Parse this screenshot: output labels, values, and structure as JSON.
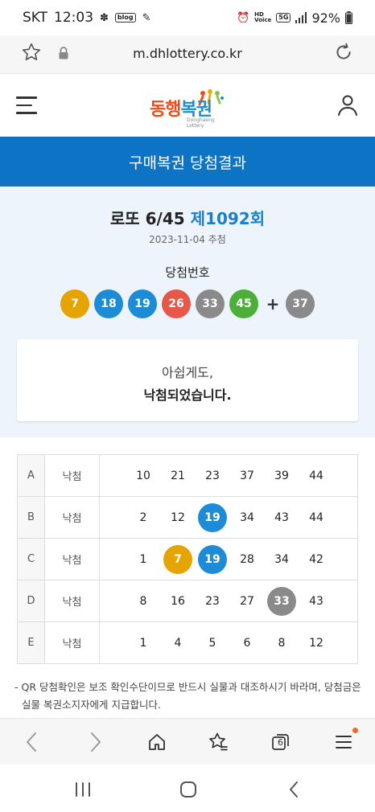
{
  "status": {
    "carrier": "SKT",
    "time": "12:03",
    "blog_badge": "blog",
    "hd_badge": "HD",
    "voice_badge": "Voice",
    "fiveg_badge": "5G",
    "battery": "92%"
  },
  "browser": {
    "url": "m.dhlottery.co.kr",
    "tab_count": "6"
  },
  "header": {
    "logo_text_1": "동행",
    "logo_text_2": "복권",
    "logo_sub": "Donghaeng Lottery"
  },
  "page": {
    "title": "구매복권 당첨결과"
  },
  "draw": {
    "game": "로또 6/45",
    "round": "제1092회",
    "date": "2023-11-04 추첨",
    "winning_label": "당첨번호",
    "balls": [
      {
        "n": "7",
        "color": "#e6a400"
      },
      {
        "n": "18",
        "color": "#1e8bd6"
      },
      {
        "n": "19",
        "color": "#1e8bd6"
      },
      {
        "n": "26",
        "color": "#e5584a"
      },
      {
        "n": "33",
        "color": "#8a8a8a"
      },
      {
        "n": "45",
        "color": "#4caf3a"
      }
    ],
    "plus": "+",
    "bonus": {
      "n": "37",
      "color": "#8a8a8a"
    }
  },
  "message": {
    "line1": "아쉽게도,",
    "line2": "낙첨되었습니다."
  },
  "tickets": [
    {
      "label": "A",
      "result": "낙첨",
      "nums": [
        {
          "n": "10"
        },
        {
          "n": "21"
        },
        {
          "n": "23"
        },
        {
          "n": "37"
        },
        {
          "n": "39"
        },
        {
          "n": "44"
        }
      ]
    },
    {
      "label": "B",
      "result": "낙첨",
      "nums": [
        {
          "n": "2"
        },
        {
          "n": "12"
        },
        {
          "n": "19",
          "hit": "#1e8bd6"
        },
        {
          "n": "34"
        },
        {
          "n": "43"
        },
        {
          "n": "44"
        }
      ]
    },
    {
      "label": "C",
      "result": "낙첨",
      "nums": [
        {
          "n": "1"
        },
        {
          "n": "7",
          "hit": "#e6a400"
        },
        {
          "n": "19",
          "hit": "#1e8bd6"
        },
        {
          "n": "28"
        },
        {
          "n": "34"
        },
        {
          "n": "42"
        }
      ]
    },
    {
      "label": "D",
      "result": "낙첨",
      "nums": [
        {
          "n": "8"
        },
        {
          "n": "16"
        },
        {
          "n": "23"
        },
        {
          "n": "27"
        },
        {
          "n": "33",
          "hit": "#8a8a8a"
        },
        {
          "n": "43"
        }
      ]
    },
    {
      "label": "E",
      "result": "낙첨",
      "nums": [
        {
          "n": "1"
        },
        {
          "n": "4"
        },
        {
          "n": "5"
        },
        {
          "n": "6"
        },
        {
          "n": "8"
        },
        {
          "n": "12"
        }
      ]
    }
  ],
  "notice": {
    "line1": "- QR 당첨확인은 보조 확인수단이므로 반드시 실물과 대조하시기 바라며, 당첨금은",
    "line2": "실물 복권소지자에게 지급합니다."
  },
  "colors": {
    "brand_blue": "#0d73c4",
    "section_bg": "#eef4fb",
    "round_blue": "#1b7fc9",
    "notify_dot": "#f06a22"
  },
  "icons": [
    "star-icon",
    "lock-icon",
    "reload-icon",
    "menu-icon",
    "user-icon",
    "back-icon",
    "forward-icon",
    "home-icon",
    "bookmarks-icon",
    "tabs-icon",
    "browser-menu-icon",
    "recent-apps-icon",
    "home-button-icon",
    "system-back-icon"
  ]
}
